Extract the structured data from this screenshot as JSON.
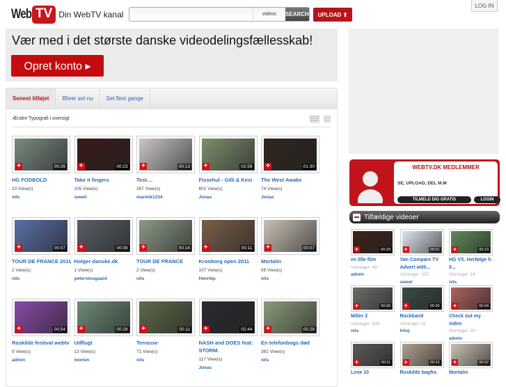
{
  "header": {
    "logo_web": "Web",
    "logo_tv": "TV",
    "tagline": "Din WebTV kanal",
    "search_placeholder": "",
    "search_scope": "videos",
    "search_label": "SEARCH",
    "upload_label": "UPLOAD ⬆",
    "login_label": "LOG IN"
  },
  "banner": {
    "headline": "Vær med i det største danske videodelingsfællesskab!",
    "cta": "Opret konto ▸"
  },
  "tabs": [
    {
      "label": "Senest tilføjet",
      "active": true
    },
    {
      "label": "Bliver set nu"
    },
    {
      "label": "Set flest gange"
    }
  ],
  "typography_link": "Ændre Typografi i oversigt",
  "videos": [
    {
      "title": "HG FODBOLD",
      "views": "23 View(s)",
      "user": "nils",
      "duration": "00:26",
      "color": "#7a8a80"
    },
    {
      "title": "Take it fingers",
      "views": "105 View(s)",
      "user": "sweet",
      "duration": "00:23",
      "color": "#3a1a1a"
    },
    {
      "title": "Test....",
      "views": "397 View(s)",
      "user": "marmik1234",
      "duration": "00:13",
      "color": "#c9c5c5"
    },
    {
      "title": "Fissehul - Gilli & Kesi",
      "views": "601 View(s)",
      "user": "Jonas",
      "duration": "02:58",
      "color": "#7d8f6c"
    },
    {
      "title": "The West Awake",
      "views": "74 View(s)",
      "user": "Jonas",
      "duration": "01:30",
      "color": "#2e261e"
    },
    {
      "title": "TOUR DE FRANCE 2011",
      "views": "2 View(s)",
      "user": "nils",
      "duration": "00:07",
      "color": "#5b6fa8"
    },
    {
      "title": "Holger-danske.dk",
      "views": "1 View(s)",
      "user": "peterstougaard",
      "duration": "00:08",
      "color": "#5a5e66"
    },
    {
      "title": "TOUR DE FRANCE",
      "views": "2 View(s)",
      "user": "nils",
      "duration": "00:14",
      "color": "#8a9a86"
    },
    {
      "title": "Kronborg open 2011",
      "views": "107 View(s)",
      "user": "Henrikp",
      "duration": "00:11",
      "color": "#7a5e4a"
    },
    {
      "title": "Mortalin",
      "views": "59 View(s)",
      "user": "nils",
      "duration": "00:07",
      "color": "#c8c0b4"
    },
    {
      "title": "Roskilde festival webtv",
      "views": "9 View(s)",
      "user": "admin",
      "duration": "00:54",
      "color": "#8a4aa8"
    },
    {
      "title": "Udflugt",
      "views": "13 View(s)",
      "user": "morten",
      "duration": "00:28",
      "color": "#6e8c78"
    },
    {
      "title": "Terrasse",
      "views": "71 View(s)",
      "user": "nils",
      "duration": "00:11",
      "color": "#5e6a4a"
    },
    {
      "title": "NASH and DOES feat: STORM.",
      "views": "117 View(s)",
      "user": "Jonas",
      "duration": "02:44",
      "color": "#2a2a30"
    },
    {
      "title": "En telefonbogs død",
      "views": "381 View(s)",
      "user": "nils",
      "duration": "00:28",
      "color": "#8a9a78"
    }
  ],
  "members": {
    "title": "WEBTV.DK MEDLEMMER",
    "subtitle": "SE, UPLOAD, DEL M.M",
    "signup": "TILMELD DIG GRATIS",
    "login": "LOGIN"
  },
  "random": {
    "heading": "Tilfældige videoer",
    "items": [
      {
        "title": "en lille film",
        "views": "Visninger: 40",
        "user": "admin",
        "duration": "00:29",
        "color": "#3a2418"
      },
      {
        "title": "Van Compare TV Advert with...",
        "views": "Visninger: 220",
        "user": "sweet",
        "duration": "00:01",
        "color": "#dfe6ee"
      },
      {
        "title": "HG VS. Herfølge 5-0...",
        "views": "Visninger: 16",
        "user": "nils",
        "duration": "00:13",
        "color": "#5e8a58"
      },
      {
        "title": "Miller 2",
        "views": "Visninger: 505",
        "user": "nils",
        "duration": "00:09",
        "color": "#6a6e68"
      },
      {
        "title": "Rockband",
        "views": "Visninger: 11",
        "user": "lrhoj",
        "duration": "00:30",
        "color": "#3a4a44"
      },
      {
        "title": "Check out my video",
        "views": "Visninger: 20",
        "user": "admin",
        "duration": "00:04",
        "color": "#b06060"
      },
      {
        "title": "Linie 10",
        "views": "",
        "user": "",
        "duration": "00:11",
        "color": "#5a5a5a"
      },
      {
        "title": "Roskilde bagfra",
        "views": "",
        "user": "",
        "duration": "00:12",
        "color": "#b0a090"
      },
      {
        "title": "Mortalin",
        "views": "",
        "user": "",
        "duration": "00:07",
        "color": "#c8c0b4"
      }
    ]
  }
}
